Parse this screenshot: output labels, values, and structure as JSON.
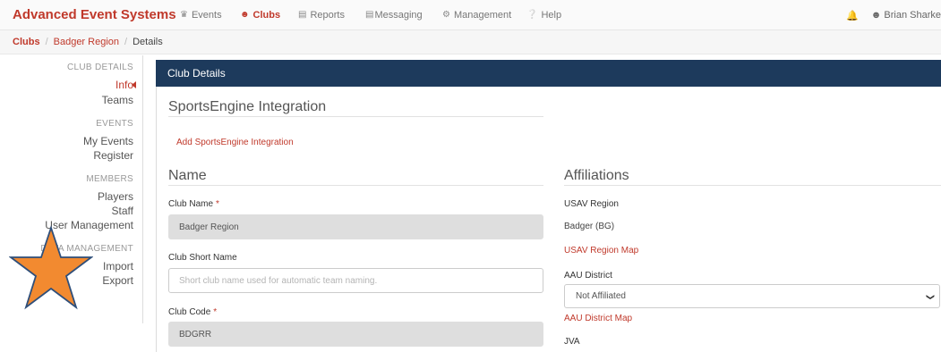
{
  "app": {
    "title": "Advanced Event Systems"
  },
  "nav": {
    "items": [
      {
        "label": "Events",
        "icon": "trophy-icon",
        "active": false
      },
      {
        "label": "Clubs",
        "icon": "users-icon",
        "active": true
      },
      {
        "label": "Reports",
        "icon": "bar-chart-icon",
        "active": false
      },
      {
        "label": "Messaging",
        "icon": "bar-chart-icon",
        "active": false
      },
      {
        "label": "Management",
        "icon": "gears-icon",
        "active": false
      },
      {
        "label": "Help",
        "icon": "question-circle-icon",
        "active": false
      }
    ],
    "user": "Brian Sharke"
  },
  "breadcrumb": {
    "c1": "Clubs",
    "c2": "Badger Region",
    "c3": "Details"
  },
  "sidebar": {
    "club_details_head": "CLUB DETAILS",
    "info": "Info",
    "teams": "Teams",
    "events_head": "EVENTS",
    "my_events": "My Events",
    "register": "Register",
    "members_head": "MEMBERS",
    "players": "Players",
    "staff": "Staff",
    "user_management": "User Management",
    "data_management_head": "DATA MANAGEMENT",
    "import": "Import",
    "export": "Export"
  },
  "panel": {
    "title": "Club Details",
    "sportsengine_title": "SportsEngine Integration",
    "add_sportsengine": "Add SportsEngine Integration",
    "name_title": "Name",
    "club_name_label": "Club Name",
    "club_name_value": "Badger Region",
    "short_name_label": "Club Short Name",
    "short_name_placeholder": "Short club name used for automatic team naming.",
    "club_code_label": "Club Code",
    "club_code_value": "BDGRR",
    "required_mark": "*",
    "affiliations_title": "Affiliations",
    "usav_label": "USAV Region",
    "usav_value": "Badger (BG)",
    "usav_map": "USAV Region Map",
    "aau_label": "AAU District",
    "aau_value": "Not Affiliated",
    "aau_map": "AAU District Map",
    "jva_label": "JVA"
  },
  "colors": {
    "brand": "#c0392b",
    "header": "#1d3a5c",
    "readonly": "#dedede",
    "star": "#f28a30"
  }
}
